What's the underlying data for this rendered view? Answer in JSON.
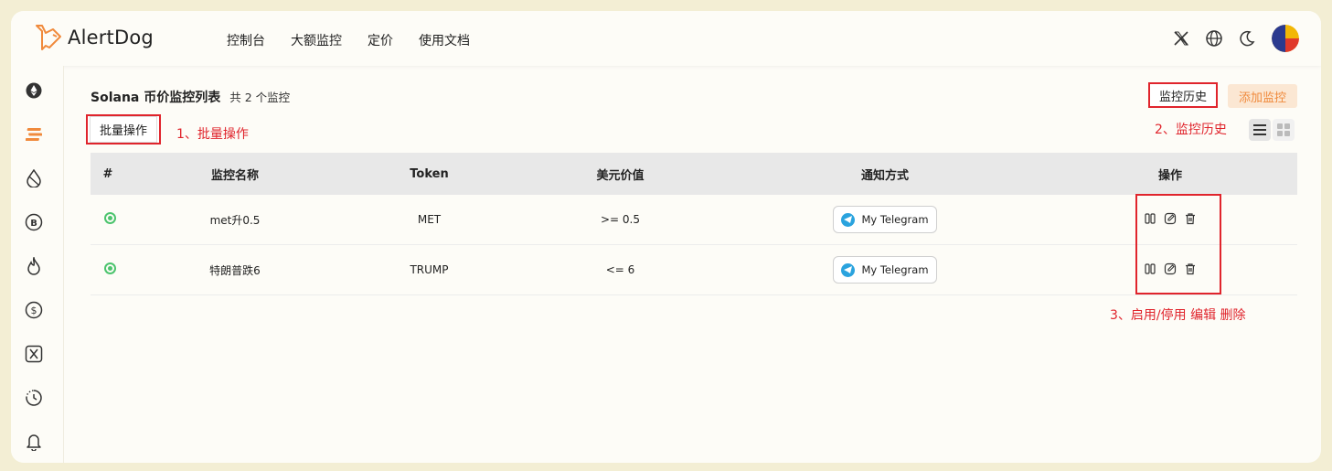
{
  "app": {
    "name": "AlertDog"
  },
  "nav": [
    "控制台",
    "大额监控",
    "定价",
    "使用文档"
  ],
  "header_icons": [
    "x-logo-icon",
    "globe-icon",
    "moon-icon",
    "avatar"
  ],
  "sidebar": [
    "ethereum-icon",
    "solana-icon",
    "drop-icon",
    "bitcoin-icon",
    "fire-icon",
    "dollar-coin-icon",
    "x-box-icon",
    "history-clock-icon",
    "bell-icon"
  ],
  "page": {
    "title": "Solana 币价监控列表",
    "count": "共 2 个监控",
    "history_button": "监控历史",
    "add_button": "添加监控",
    "batch_button": "批量操作"
  },
  "annotations": {
    "batch": "1、批量操作",
    "history": "2、监控历史",
    "actions": "3、启用/停用 编辑 删除"
  },
  "table": {
    "headers": [
      "#",
      "监控名称",
      "Token",
      "美元价值",
      "通知方式",
      "操作"
    ],
    "rows": [
      {
        "status": "active",
        "name": "met升0.5",
        "token": "MET",
        "usd_value": ">= 0.5",
        "notify": "My Telegram"
      },
      {
        "status": "active",
        "name": "特朗普跌6",
        "token": "TRUMP",
        "usd_value": "<= 6",
        "notify": "My Telegram"
      }
    ]
  },
  "colors": {
    "accent": "#f08a3c",
    "annotation_red": "#e0242c",
    "status_green": "#4cc46e",
    "telegram_blue": "#2aa3de"
  }
}
